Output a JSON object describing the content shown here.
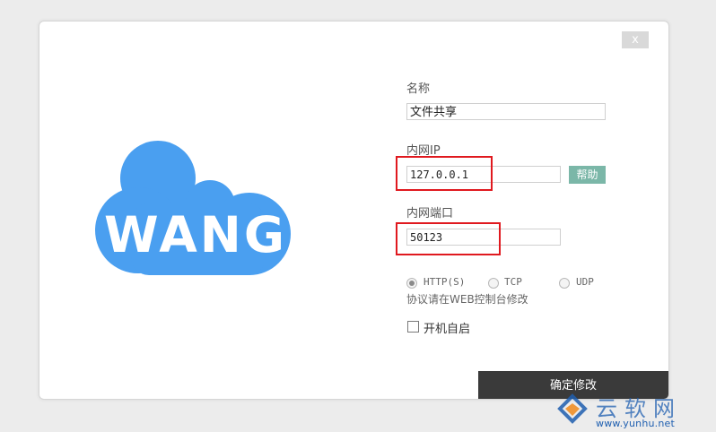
{
  "dialog": {
    "close_label": "x"
  },
  "logo": {
    "text": "WANG"
  },
  "form": {
    "name_label": "名称",
    "name_value": "文件共享",
    "ip_label": "内网IP",
    "ip_value": "127.0.0.1",
    "help_label": "帮助",
    "port_label": "内网端口",
    "port_value": "50123",
    "protocols": [
      {
        "label": "HTTP(S)",
        "selected": true
      },
      {
        "label": "TCP",
        "selected": false
      },
      {
        "label": "UDP",
        "selected": false
      }
    ],
    "protocol_note": "协议请在WEB控制台修改",
    "autostart_label": "开机自启",
    "autostart_checked": false,
    "submit_label": "确定修改"
  },
  "watermark": {
    "text": "云软网",
    "url": "www.yunhu.net"
  },
  "colors": {
    "cloud": "#4a9ff0",
    "help_button": "#7bb7a8",
    "submit_button": "#3a3a3a",
    "highlight": "#e0191f"
  }
}
